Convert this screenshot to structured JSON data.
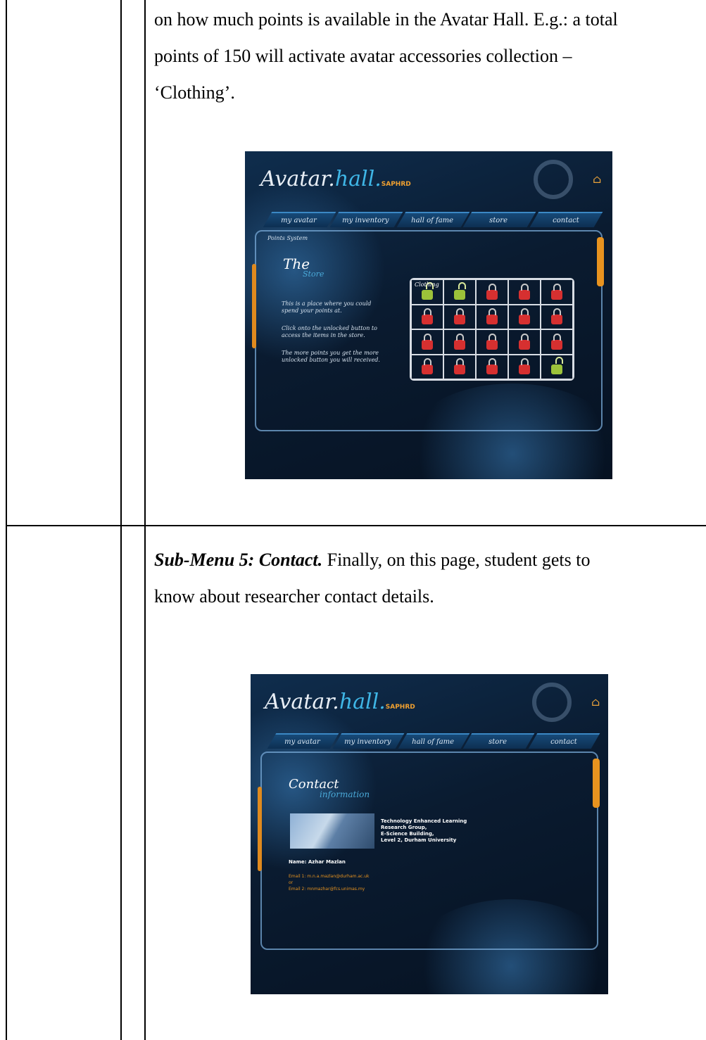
{
  "para1": {
    "line1": "on how much points is available in the Avatar Hall.  E.g.: a total",
    "line2": "points of 150 will activate avatar accessories collection –",
    "line3": "‘Clothing’."
  },
  "para2": {
    "heading": "Sub-Menu 5: Contact.",
    "line1_rest": " Finally, on this page, student gets to",
    "line2": "know about researcher contact details."
  },
  "app": {
    "logo_avatar": "Avatar.",
    "logo_hall": "hall.",
    "logo_brand": "SAPHRD",
    "nav": [
      "my avatar",
      "my inventory",
      "hall of fame",
      "store",
      "contact"
    ]
  },
  "store_screen": {
    "breadcrumb": "Points System",
    "title_main": "The",
    "title_sub": "Store",
    "desc1": "This is a place where you could spend your points at.",
    "desc2": "Click onto the unlocked button to access the items in the store.",
    "desc3": "The more points you get the more unlocked button you will received.",
    "first_item_label": "Clothing",
    "locks": [
      "green",
      "green",
      "red",
      "red",
      "red",
      "red",
      "red",
      "red",
      "red",
      "red",
      "red",
      "red",
      "red",
      "red",
      "red",
      "red",
      "red",
      "red",
      "red",
      "green"
    ]
  },
  "contact_screen": {
    "title_main": "Contact",
    "title_sub": "information",
    "address": [
      "Technology Enhanced Learning",
      "Research Group,",
      "E-Science Building,",
      "Level 2, Durham University"
    ],
    "name": "Name:  Azhar Mazlan",
    "email1": "Email 1: m.n.a.mazlan@durham.ac.uk",
    "or": "or",
    "email2": "Email 2: mnmazhar@fcs.unimas.my"
  }
}
